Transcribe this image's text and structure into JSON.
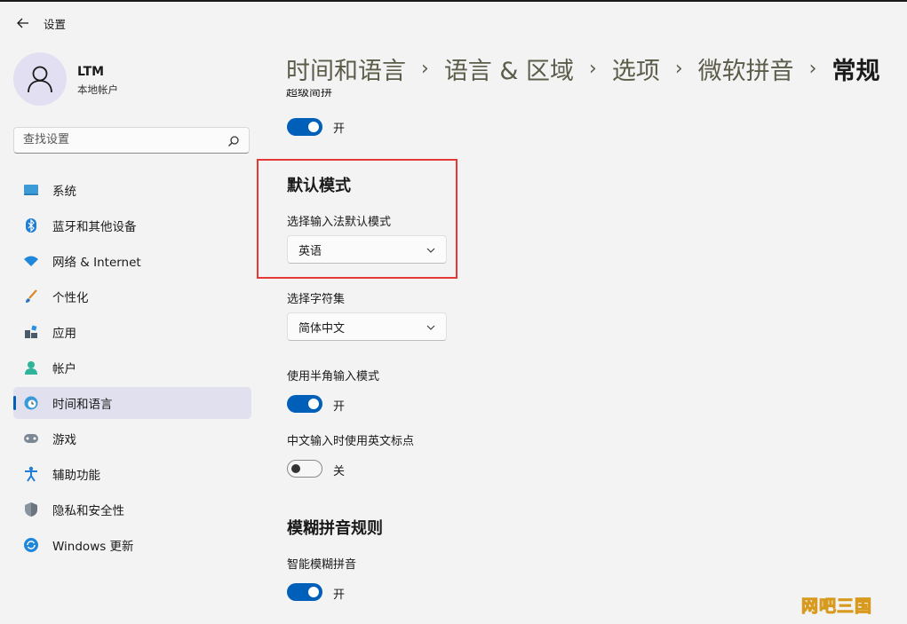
{
  "app": {
    "title": "设置"
  },
  "user": {
    "name": "LTM",
    "subtitle": "本地帐户"
  },
  "search": {
    "placeholder": "查找设置"
  },
  "sidebar": {
    "items": [
      {
        "label": "系统",
        "icon": "system-icon"
      },
      {
        "label": "蓝牙和其他设备",
        "icon": "bluetooth-icon"
      },
      {
        "label": "网络 & Internet",
        "icon": "wifi-icon"
      },
      {
        "label": "个性化",
        "icon": "brush-icon"
      },
      {
        "label": "应用",
        "icon": "apps-icon"
      },
      {
        "label": "帐户",
        "icon": "account-icon"
      },
      {
        "label": "时间和语言",
        "icon": "time-language-icon",
        "active": true
      },
      {
        "label": "游戏",
        "icon": "gamepad-icon"
      },
      {
        "label": "辅助功能",
        "icon": "accessibility-icon"
      },
      {
        "label": "隐私和安全性",
        "icon": "shield-icon"
      },
      {
        "label": "Windows 更新",
        "icon": "windows-update-icon"
      }
    ]
  },
  "breadcrumb": {
    "items": [
      "时间和语言",
      "语言 & 区域",
      "选项",
      "微软拼音"
    ],
    "current": "常规",
    "separator": "›"
  },
  "main": {
    "clipped_heading": "超级简拼",
    "superjianpin": {
      "state": "开",
      "on": true
    },
    "default_mode": {
      "title": "默认模式",
      "label": "选择输入法默认模式",
      "value": "英语"
    },
    "charset": {
      "label": "选择字符集",
      "value": "简体中文"
    },
    "half_width": {
      "label": "使用半角输入模式",
      "state": "开",
      "on": true
    },
    "english_punct": {
      "label": "中文输入时使用英文标点",
      "state": "关",
      "on": false
    },
    "fuzzy": {
      "title": "模糊拼音规则",
      "smart_label": "智能模糊拼音",
      "smart_state": "开",
      "smart_on": true
    }
  },
  "watermark": "网吧三国",
  "colors": {
    "accent": "#005fb8",
    "highlight_box": "#e53935",
    "active_nav_bg": "#e0e0ef"
  }
}
